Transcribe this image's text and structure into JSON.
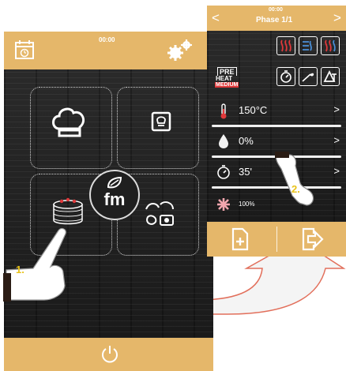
{
  "left_screen": {
    "time": "00:00",
    "icons": {
      "calendar": "calendar-clock-icon",
      "settings": "gears-icon",
      "chef": "chef-hat-icon",
      "recipe_book": "recipe-book-icon",
      "cake": "cake-icon",
      "cooking_modes": "cooking-modes-icon",
      "power": "power-icon"
    },
    "logo_text": "fm"
  },
  "right_screen": {
    "time": "00:00",
    "title": "Phase 1/1",
    "nav_prev": "<",
    "nav_next": ">",
    "preheat": {
      "line1": "PRE",
      "line2": "HEAT",
      "line3": "MEDIUM"
    },
    "rows": [
      {
        "icon": "thermometer-icon",
        "value": "150°C",
        "chevron": ">"
      },
      {
        "icon": "humidity-drop-icon",
        "value": "0%",
        "chevron": ">"
      },
      {
        "icon": "timer-icon",
        "value": "35'",
        "chevron": ">"
      }
    ],
    "fan_value": "100%"
  },
  "steps": {
    "first": "1.",
    "second": "2."
  },
  "colors": {
    "accent": "#e5b76a",
    "heat_red": "#e0393b",
    "step_yellow": "#e8c21a"
  }
}
